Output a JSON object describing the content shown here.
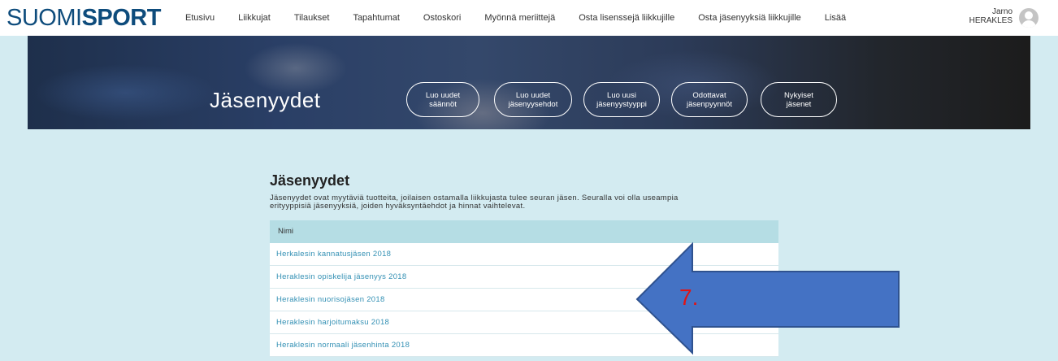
{
  "header": {
    "logo_part1": "SUOMI",
    "logo_part2": "SPORT",
    "nav": [
      "Etusivu",
      "Liikkujat",
      "Tilaukset",
      "Tapahtumat",
      "Ostoskori",
      "Myönnä meriittejä",
      "Osta lisenssejä liikkujille",
      "Osta jäsenyyksiä liikkujille",
      "Lisää"
    ],
    "user_name": "Jarno",
    "user_org": "HERAKLES"
  },
  "hero": {
    "title": "Jäsenyydet",
    "buttons": [
      {
        "line1": "Luo uudet",
        "line2": "säännöt"
      },
      {
        "line1": "Luo uudet",
        "line2": "jäsenyysehdot"
      },
      {
        "line1": "Luo uusi",
        "line2": "jäsenyystyyppi"
      },
      {
        "line1": "Odottavat",
        "line2": "jäsenpyynnöt"
      },
      {
        "line1": "Nykyiset",
        "line2": "jäsenet"
      }
    ]
  },
  "main": {
    "title": "Jäsenyydet",
    "description_line1": "Jäsenyydet ovat myytäviä tuotteita, joilaisen ostamalla liikkujasta tulee seuran jäsen. Seuralla voi olla useampia",
    "description_line2": "erityyppisiä jäsenyyksiä, joiden hyväksyntäehdot ja hinnat vaihtelevat.",
    "column_header": "Nimi",
    "rows": [
      "Herkalesin kannatusjäsen 2018",
      "Heraklesin opiskelija jäsenyys 2018",
      "Heraklesin nuorisojäsen 2018",
      "Heraklesin harjoitumaksu 2018",
      "Heraklesin normaali jäsenhinta 2018"
    ]
  },
  "annotation": {
    "label": "7.",
    "label_color": "#e01414",
    "arrow_color": "#4472c4"
  }
}
